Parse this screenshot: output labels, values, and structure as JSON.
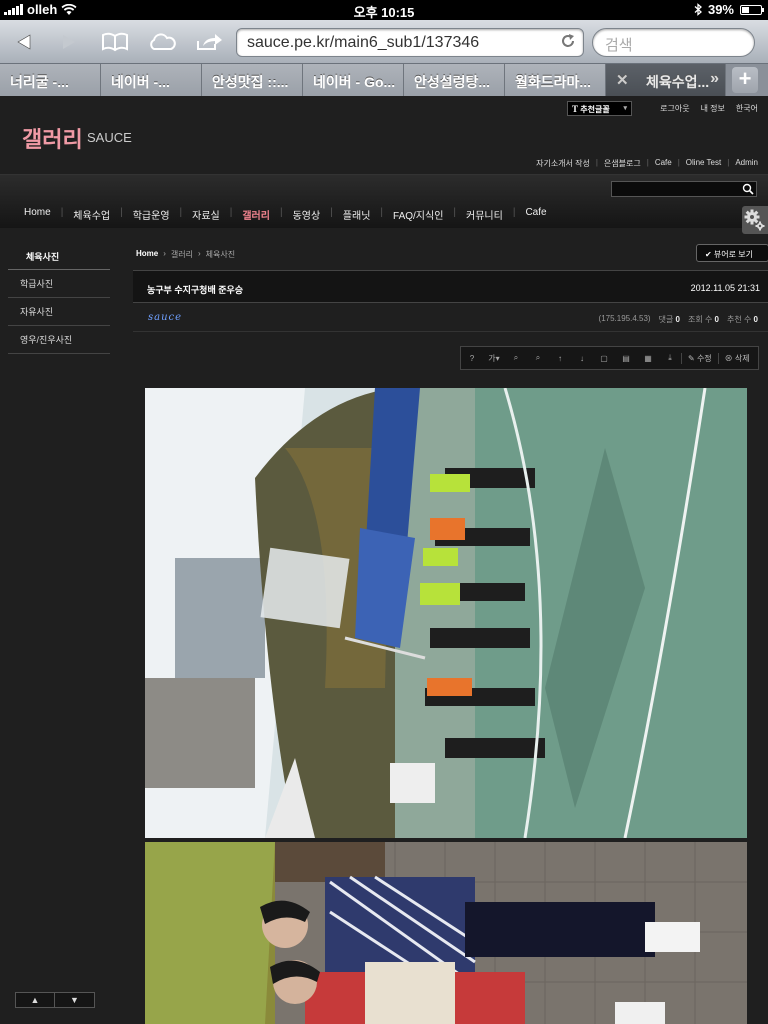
{
  "status": {
    "carrier": "olleh",
    "time": "오후 10:15",
    "battery": "39%",
    "battery_level": 0.39
  },
  "browser": {
    "url": "sauce.pe.kr/main6_sub1/137346",
    "search_placeholder": "검색",
    "tabs": [
      {
        "label": "너리굴 -..."
      },
      {
        "label": "네이버 -..."
      },
      {
        "label": "안성맛집 ::..."
      },
      {
        "label": "네이버 - Go..."
      },
      {
        "label": "안성설렁탕..."
      },
      {
        "label": "월화드라마..."
      },
      {
        "label": "체육수업..."
      }
    ]
  },
  "site": {
    "lang_select": "추천글꼴",
    "lang_mark": "T",
    "top_links": [
      "로그아웃",
      "내 정보",
      "한국어"
    ],
    "logo": "갤러리",
    "logo_sub": "SAUCE",
    "util_links": [
      "자기소개서 작성",
      "은샘블로그",
      "Cafe",
      "Oline Test",
      "Admin"
    ],
    "menu": [
      {
        "label": "Home",
        "active": false
      },
      {
        "label": "체육수업",
        "active": false
      },
      {
        "label": "학급운영",
        "active": false
      },
      {
        "label": "자료실",
        "active": false
      },
      {
        "label": "갤러리",
        "active": true
      },
      {
        "label": "동영상",
        "active": false
      },
      {
        "label": "플래닛",
        "active": false
      },
      {
        "label": "FAQ/지식인",
        "active": false
      },
      {
        "label": "커뮤니티",
        "active": false
      },
      {
        "label": "Cafe",
        "active": false
      }
    ],
    "side": {
      "heading": "체육사진",
      "items": [
        "학급사진",
        "자유사진",
        "영우/진우사진"
      ]
    },
    "breadcrumb": {
      "home": "Home",
      "sep": "›",
      "level1": "갤러리",
      "level2": "체육사진"
    },
    "viewer_button": "✔ 뷰어로 보기",
    "post": {
      "title": "농구부 수지구청배 준우승",
      "date": "2012.11.05 21:31",
      "author": "sauce",
      "ip": "(175.195.4.53)",
      "comments_label": "댓글",
      "comments": "0",
      "views_label": "조회 수",
      "views": "0",
      "recommend_label": "추천 수",
      "recommend": "0"
    },
    "tools": {
      "font": "가▾",
      "edit": "수정",
      "delete": "삭제"
    }
  }
}
